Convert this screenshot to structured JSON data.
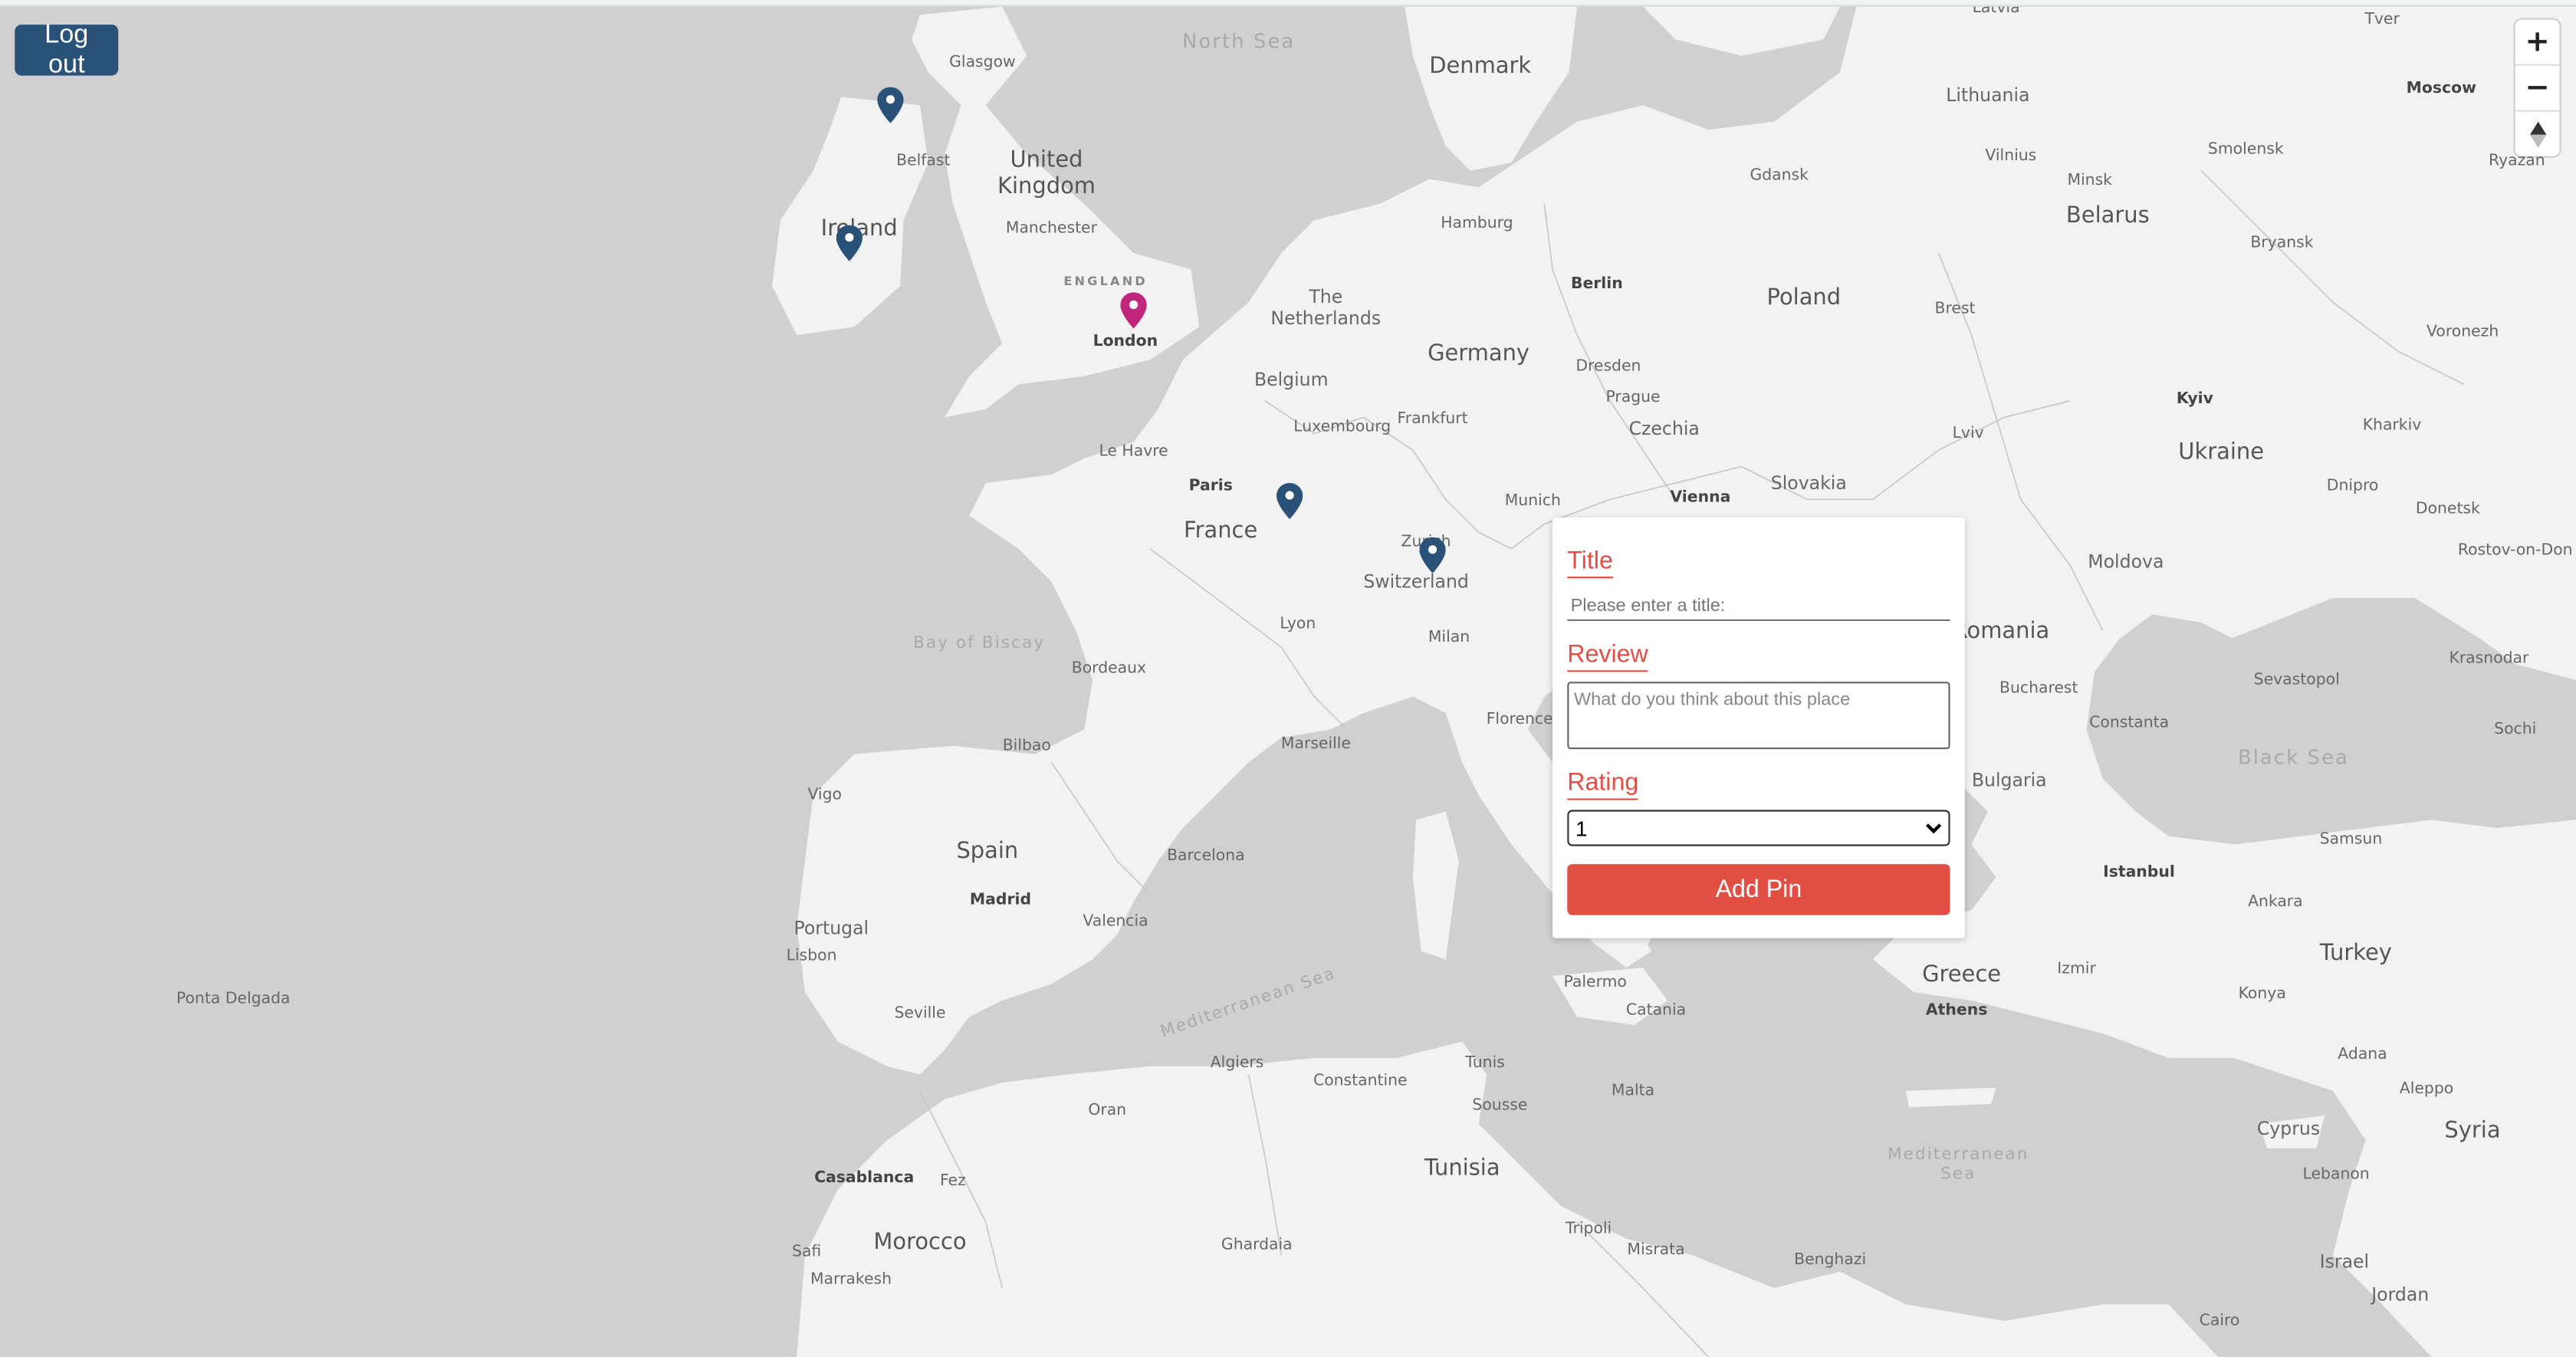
{
  "header": {
    "logout_label": "Log out"
  },
  "map": {
    "zoom_in": "+",
    "zoom_out": "−",
    "reset_bearing": "⇧",
    "labels": {
      "north_sea": "North Sea",
      "denmark": "Denmark",
      "lithuania": "Lithuania",
      "latvia": "Latvia",
      "tver": "Tver",
      "moscow": "Moscow",
      "glasgow": "Glasgow",
      "belfast": "Belfast",
      "united_kingdom": "United\nKingdom",
      "ireland": "Ireland",
      "manchester": "Manchester",
      "england": "ENGLAND",
      "london": "London",
      "hamburg": "Hamburg",
      "gdansk": "Gdansk",
      "vilnius": "Vilnius",
      "minsk": "Minsk",
      "smolensk": "Smolensk",
      "ryazan": "Ryazan",
      "belarus": "Belarus",
      "bryansk": "Bryansk",
      "the_netherlands": "The\nNetherlands",
      "berlin": "Berlin",
      "poland": "Poland",
      "brest": "Brest",
      "germany": "Germany",
      "belgium": "Belgium",
      "dresden": "Dresden",
      "prague": "Prague",
      "voronezh": "Voronezh",
      "kyiv": "Kyiv",
      "luxembourg": "Luxembourg",
      "frankfurt": "Frankfurt",
      "czechia": "Czechia",
      "lviv": "Lviv",
      "ukraine": "Ukraine",
      "kharkiv": "Kharkiv",
      "le_havre": "Le Havre",
      "paris": "Paris",
      "slovakia": "Slovakia",
      "dnipro": "Dnipro",
      "donetsk": "Donetsk",
      "munich": "Munich",
      "vienna": "Vienna",
      "france": "France",
      "zurich": "Zurich",
      "rostov": "Rostov-on-Don",
      "moldova": "Moldova",
      "switzerland": "Switzerland",
      "lyon": "Lyon",
      "milan": "Milan",
      "romania": "Romania",
      "bay_of_biscay": "Bay of Biscay",
      "bordeaux": "Bordeaux",
      "sevastopol": "Sevastopol",
      "krasnodar": "Krasnodar",
      "bucharest": "Bucharest",
      "constanta": "Constanta",
      "sochi": "Sochi",
      "florence": "Florence",
      "bilbao": "Bilbao",
      "marseille": "Marseille",
      "black_sea": "Black Sea",
      "vigo": "Vigo",
      "bulgaria": "Bulgaria",
      "spain": "Spain",
      "barcelona": "Barcelona",
      "samsun": "Samsun",
      "madrid": "Madrid",
      "istanbul": "Istanbul",
      "ankara": "Ankara",
      "portugal": "Portugal",
      "valencia": "Valencia",
      "lisbon": "Lisbon",
      "turkey": "Turkey",
      "greece": "Greece",
      "izmir": "Izmir",
      "palermo": "Palermo",
      "ponta_delgada": "Ponta Delgada",
      "seville": "Seville",
      "catania": "Catania",
      "athens": "Athens",
      "konya": "Konya",
      "mediterranean_sea_w": "Mediterranean Sea",
      "adana": "Adana",
      "algiers": "Algiers",
      "tunis": "Tunis",
      "constantine": "Constantine",
      "aleppo": "Aleppo",
      "oran": "Oran",
      "sousse": "Sousse",
      "malta": "Malta",
      "cyprus": "Cyprus",
      "syria": "Syria",
      "mediterranean_sea_e": "Mediterranean\nSea",
      "tunisia": "Tunisia",
      "casablanca": "Casablanca",
      "fez": "Fez",
      "lebanon": "Lebanon",
      "morocco": "Morocco",
      "tripoli": "Tripoli",
      "ghardaia": "Ghardaia",
      "safi": "Safi",
      "misrata": "Misrata",
      "benghazi": "Benghazi",
      "israel": "Israel",
      "marrakesh": "Marrakesh",
      "jordan": "Jordan",
      "cairo": "Cairo"
    },
    "pins": [
      {
        "place": "Northern Ireland",
        "color": "#2a5278"
      },
      {
        "place": "Ireland",
        "color": "#2a5278"
      },
      {
        "place": "London",
        "color": "#c0267c"
      },
      {
        "place": "France (Champagne)",
        "color": "#2a5278"
      },
      {
        "place": "Zurich",
        "color": "#2a5278"
      }
    ]
  },
  "form": {
    "title_label": "Title",
    "title_placeholder": "Please enter a title:",
    "review_label": "Review",
    "review_placeholder": "What do you think about this place",
    "rating_label": "Rating",
    "rating_value": "1",
    "submit_label": "Add Pin"
  },
  "colors": {
    "accent": "#e04e44",
    "logout_bg": "#2a5278",
    "pin_default": "#2a5278",
    "pin_selected": "#c0267c",
    "water": "#d0d0d0",
    "land": "#f2f2f2"
  }
}
